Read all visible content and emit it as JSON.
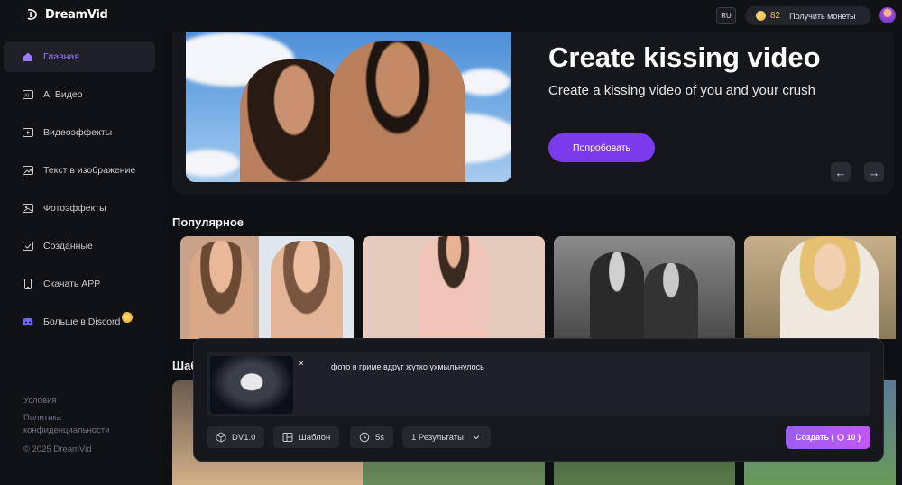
{
  "app": {
    "name": "DreamVid"
  },
  "topbar": {
    "lang": "RU",
    "coins": "82",
    "coins_label": "Получить монеты"
  },
  "sidebar": {
    "items": [
      {
        "label": "Главная",
        "icon": "home-icon"
      },
      {
        "label": "AI Видео",
        "icon": "ai-video-icon"
      },
      {
        "label": "Видеоэффекты",
        "icon": "video-effects-icon"
      },
      {
        "label": "Текст в изображение",
        "icon": "text-to-image-icon"
      },
      {
        "label": "Фотоэффекты",
        "icon": "photo-effects-icon"
      },
      {
        "label": "Созданные",
        "icon": "created-icon"
      },
      {
        "label": "Скачать APP",
        "icon": "phone-icon"
      },
      {
        "label": "Больше в Discord",
        "icon": "discord-icon"
      }
    ],
    "footer": {
      "terms": "Условия",
      "privacy": "Политика конфиденциальности",
      "copyright": "© 2025 DreamVid"
    }
  },
  "hero": {
    "title": "Create kissing video",
    "subtitle": "Create a kissing video of you and your crush",
    "button": "Попробовать",
    "prev": "←",
    "next": "→"
  },
  "sections": {
    "popular": "Популярное",
    "templates": "Шаб"
  },
  "prompt": {
    "text": "фото в гриме вдруг жутко ухмыльнулось",
    "close": "×",
    "model": "DV1.0",
    "template": "Шаблон",
    "duration": "5s",
    "results": "1 Результаты",
    "create": "Создать ( ",
    "create_cost": "10 )"
  },
  "colors": {
    "accent": "#7c3aed",
    "background": "#0f1014"
  }
}
